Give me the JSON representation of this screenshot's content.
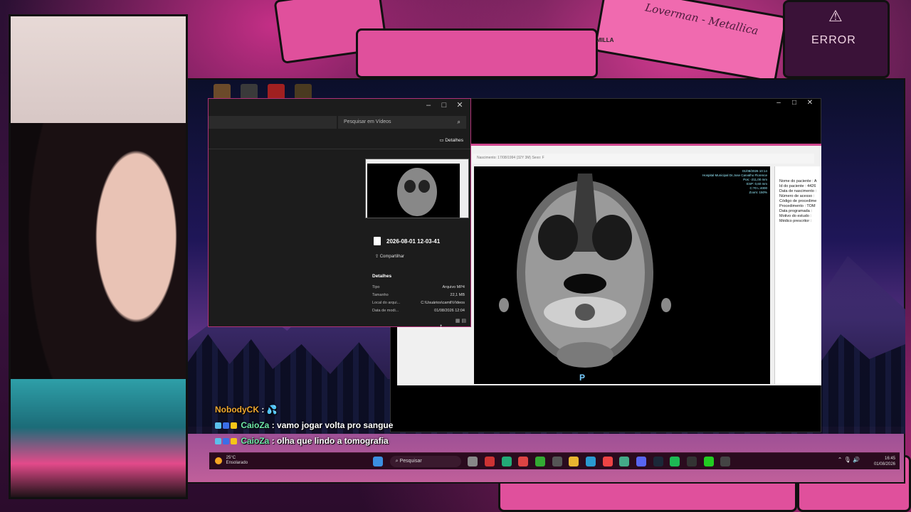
{
  "background": {
    "error_label": "ERROR",
    "error_icon": "warning-triangle-icon",
    "tape_label": "Loverman - Metallica",
    "tape_brand": "MILLA"
  },
  "explorer": {
    "search_placeholder": "Pesquisar em Vídeos",
    "details_button": "Detalhes",
    "file_name": "2026-08-01 12-03-41",
    "share_label": "Compartilhar",
    "details_title": "Detalhes",
    "details": [
      {
        "label": "Tipo",
        "value": "Arquivo MP4"
      },
      {
        "label": "Tamanho",
        "value": "22,1 MB"
      },
      {
        "label": "Local do arqui...",
        "value": "C:\\Usuários\\camil\\Vídeos"
      },
      {
        "label": "Data de modi...",
        "value": "01/08/2026 12:04"
      }
    ]
  },
  "ct_viewer": {
    "header_text": "Nascimento: 17/08/1994 (32Y 3M)      Sexo: F",
    "image_info": [
      "01/08/2026 10:14",
      "Hospital Municipal Dr.Jose Carvalho Florence",
      "Pos: -211,00 mm",
      "ESP: 0,60 mm",
      "C:70 L:4000",
      "Zoom: 150%"
    ],
    "orientation_marker": "P",
    "patient_fields": [
      "Nome do paciente : A",
      "Id do paciente : 4426",
      "Data de nascimento :",
      "Número de acesso :",
      "Código de procedime",
      "Procedimento : TOM",
      "Data programada :",
      "Motivo do estudo :",
      "Médico prescritor :"
    ]
  },
  "chat": [
    {
      "user": "NobodyCK",
      "text": ": 💦",
      "color": "orange",
      "badges": 0
    },
    {
      "user": "CaioZa",
      "text": ": vamo jogar volta pro sangue",
      "color": "green",
      "badges": 3
    },
    {
      "user": "CaioZa",
      "text": ": olha que lindo a tomografia",
      "color": "green",
      "badges": 3
    }
  ],
  "taskbar": {
    "weather_temp": "25°C",
    "weather_desc": "Ensolarado",
    "search_label": "Pesquisar",
    "time": "16:45",
    "date": "01/08/2026"
  },
  "colors": {
    "accent": "#d1478f",
    "taskbar_bg": "#2a0b1e",
    "chat_orange": "#f0a830",
    "chat_green": "#6fe8a8"
  }
}
